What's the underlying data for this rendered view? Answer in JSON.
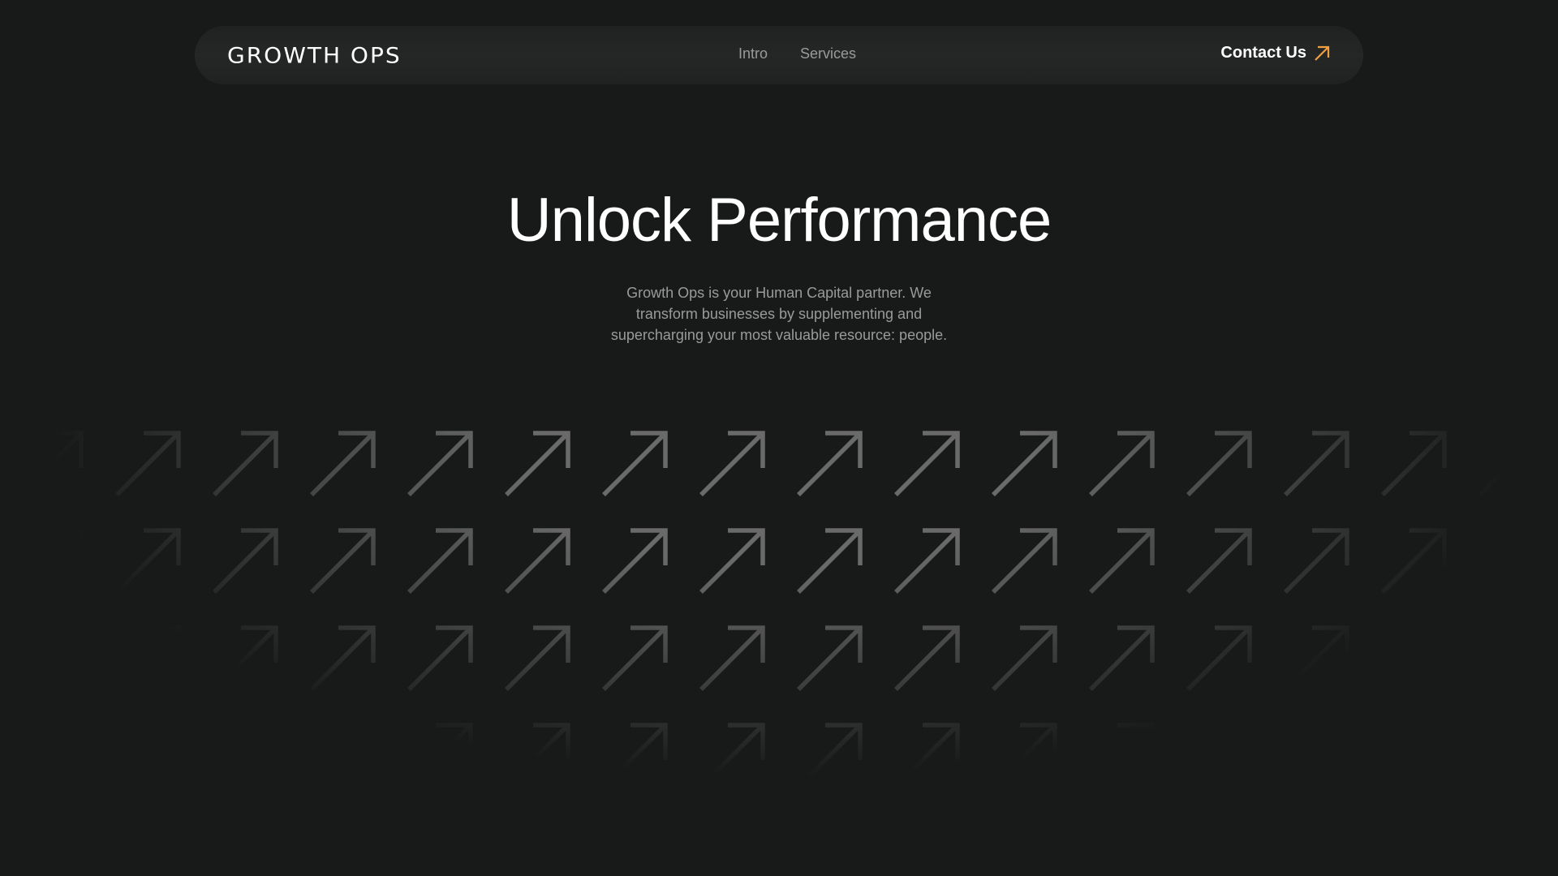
{
  "nav": {
    "logo": "GROWTH OPS",
    "links": [
      "Intro",
      "Services"
    ],
    "contact_label": "Contact Us",
    "contact_icon": "arrow-up-right-icon"
  },
  "hero": {
    "title": "Unlock Performance",
    "subtitle": "Growth Ops is your Human Capital partner. We transform businesses by supplementing and supercharging your most valuable resource: people."
  },
  "background": {
    "icon": "arrow-up-right-icon",
    "rows": 4,
    "columns": 16
  },
  "colors": {
    "background": "#181a19",
    "nav_background": "#232524",
    "accent": "#f0a040",
    "muted_text": "#9a9a9a",
    "pattern": "#6a6a6a"
  }
}
